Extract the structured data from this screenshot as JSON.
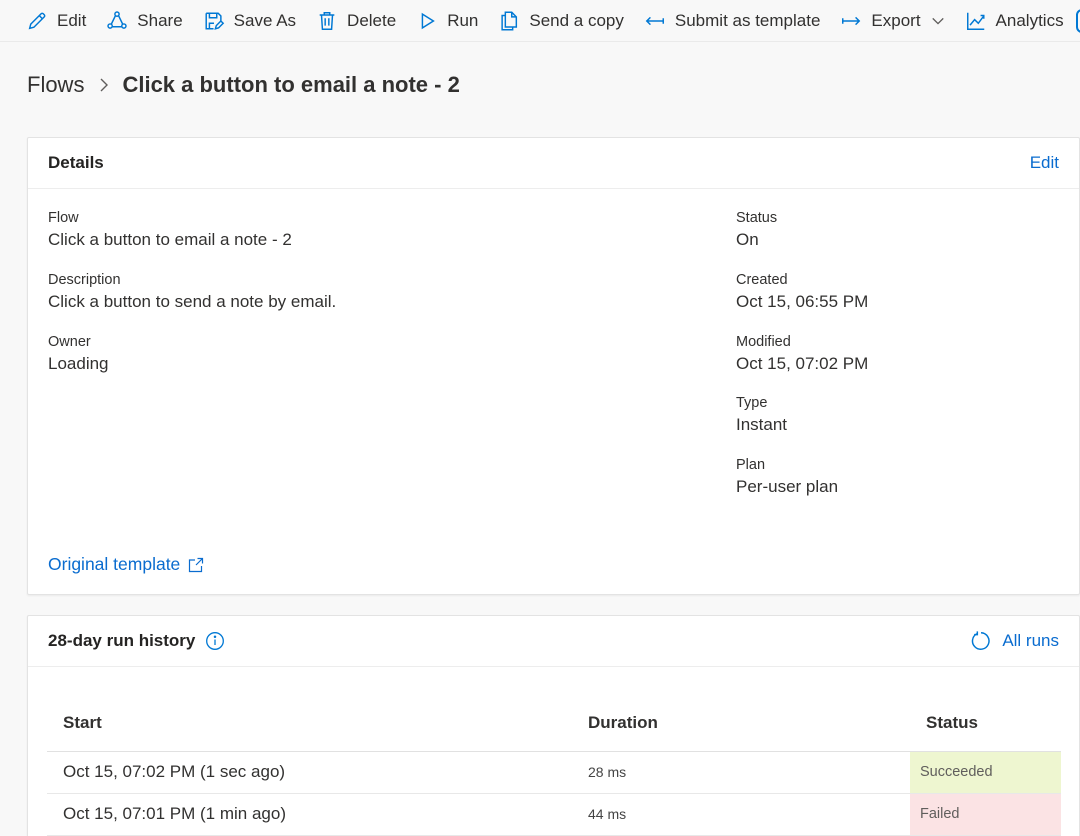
{
  "toolbar": {
    "items": [
      {
        "label": "Edit",
        "icon": "pencil-icon"
      },
      {
        "label": "Share",
        "icon": "share-icon"
      },
      {
        "label": "Save As",
        "icon": "save-as-icon"
      },
      {
        "label": "Delete",
        "icon": "trash-icon"
      },
      {
        "label": "Run",
        "icon": "play-icon"
      },
      {
        "label": "Send a copy",
        "icon": "copy-icon"
      },
      {
        "label": "Submit as template",
        "icon": "arrow-left-icon"
      },
      {
        "label": "Export",
        "icon": "arrow-right-icon"
      },
      {
        "label": "Analytics",
        "icon": "chart-icon"
      }
    ]
  },
  "breadcrumb": {
    "root": "Flows",
    "current": "Click a button to email a note - 2"
  },
  "details": {
    "title": "Details",
    "edit_label": "Edit",
    "left_fields": [
      {
        "label": "Flow",
        "value": "Click a button to email a note - 2"
      },
      {
        "label": "Description",
        "value": "Click a button to send a note by email."
      },
      {
        "label": "Owner",
        "value": "Loading"
      }
    ],
    "right_fields": [
      {
        "label": "Status",
        "value": "On"
      },
      {
        "label": "Created",
        "value": "Oct 15, 06:55 PM"
      },
      {
        "label": "Modified",
        "value": "Oct 15, 07:02 PM"
      },
      {
        "label": "Type",
        "value": "Instant"
      },
      {
        "label": "Plan",
        "value": "Per-user plan"
      }
    ],
    "template_link": "Original template"
  },
  "history": {
    "title": "28-day run history",
    "all_runs_label": "All runs",
    "columns": [
      "Start",
      "Duration",
      "Status"
    ],
    "rows": [
      {
        "start": "Oct 15, 07:02 PM (1 sec ago)",
        "duration": "28 ms",
        "status": "Succeeded"
      },
      {
        "start": "Oct 15, 07:01 PM (1 min ago)",
        "duration": "44 ms",
        "status": "Failed"
      }
    ]
  },
  "colors": {
    "accent": "#0078d4",
    "link": "#0a6ccf",
    "succeeded_bg": "#eef6d0",
    "failed_bg": "#fbe3e4"
  }
}
